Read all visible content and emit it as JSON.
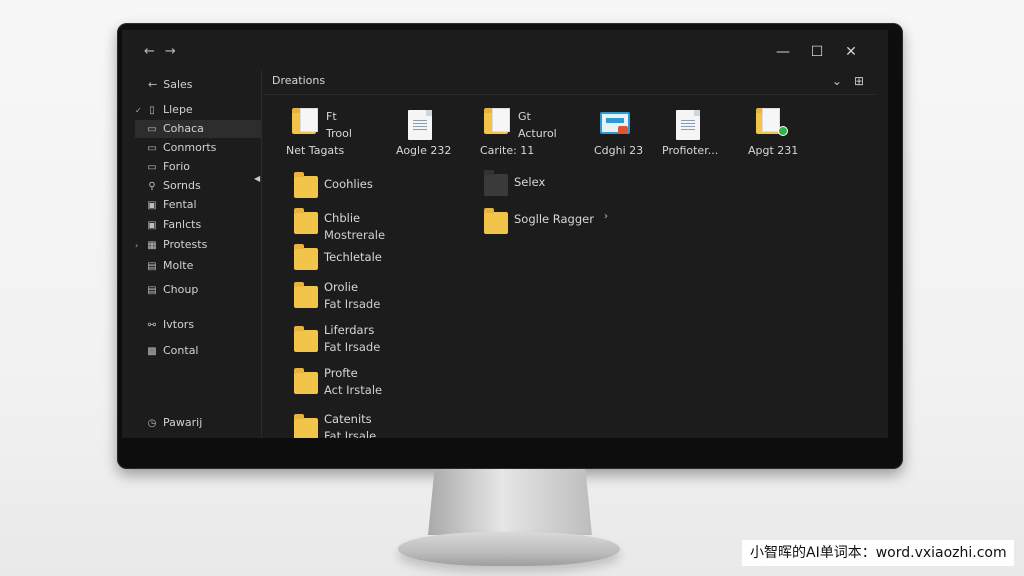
{
  "window": {
    "nav_back": "←",
    "nav_forward": "→",
    "minimize": "—",
    "maximize": "☐",
    "close": "✕"
  },
  "sidebar": {
    "header": "Sales",
    "items": [
      {
        "label": "Llepe",
        "icon": "document-icon",
        "chevron": "expanded"
      },
      {
        "label": "Cohaca",
        "icon": "folder-icon",
        "active": true
      },
      {
        "label": "Conmorts",
        "icon": "document-icon"
      },
      {
        "label": "Forio",
        "icon": "document-icon"
      },
      {
        "label": "Sornds",
        "icon": "link-icon"
      },
      {
        "label": "Fental",
        "icon": "image-icon"
      },
      {
        "label": "Fanlcts",
        "icon": "image-icon"
      },
      {
        "label": "Protests",
        "icon": "grid-icon",
        "chevron": "collapsed"
      },
      {
        "label": "Molte",
        "icon": "calendar-icon"
      },
      {
        "label": "Choup",
        "icon": "group-icon"
      },
      {
        "label": "Ivtors",
        "icon": "link-icon"
      },
      {
        "label": "Contal",
        "icon": "people-icon"
      },
      {
        "label": "Pawarij",
        "icon": "clock-icon"
      }
    ]
  },
  "address": {
    "title": "Dreations",
    "chevron": "⌄",
    "view": "⊞"
  },
  "tiles_top": [
    {
      "lines": [
        "Ft",
        "Trool",
        "Net Tagats"
      ],
      "icon": "folder-document-icon"
    },
    {
      "lines": [
        "Aogle 232"
      ],
      "icon": "document-icon"
    },
    {
      "lines": [
        "Gt",
        "Acturol",
        "Carite: 11"
      ],
      "icon": "folder-document-icon"
    },
    {
      "lines": [
        "Cdghi 23"
      ],
      "icon": "image-badge-icon"
    },
    {
      "lines": [
        "Profioter..."
      ],
      "icon": "document-icon"
    },
    {
      "lines": [
        "Apgt 231"
      ],
      "icon": "folder-sync-icon"
    }
  ],
  "list_left": [
    {
      "line1": "Coohlies"
    },
    {
      "line1": "Chblie",
      "line2": "Mostrerale"
    },
    {
      "line1": "Techletale"
    },
    {
      "line1": "Orolie",
      "line2": "Fat Irsade"
    },
    {
      "line1": "Liferdars",
      "line2": "Fat Irsade"
    },
    {
      "line1": "Profte",
      "line2": "Act Irstale"
    },
    {
      "line1": "Catenits",
      "line2": "Fat Irsale"
    }
  ],
  "list_right": [
    {
      "line1": "Selex",
      "dark": true
    },
    {
      "line1": "Soglle Ragger",
      "chevron": "›"
    }
  ],
  "watermark": "小智晖的AI单词本：word.vxiaozhi.com"
}
